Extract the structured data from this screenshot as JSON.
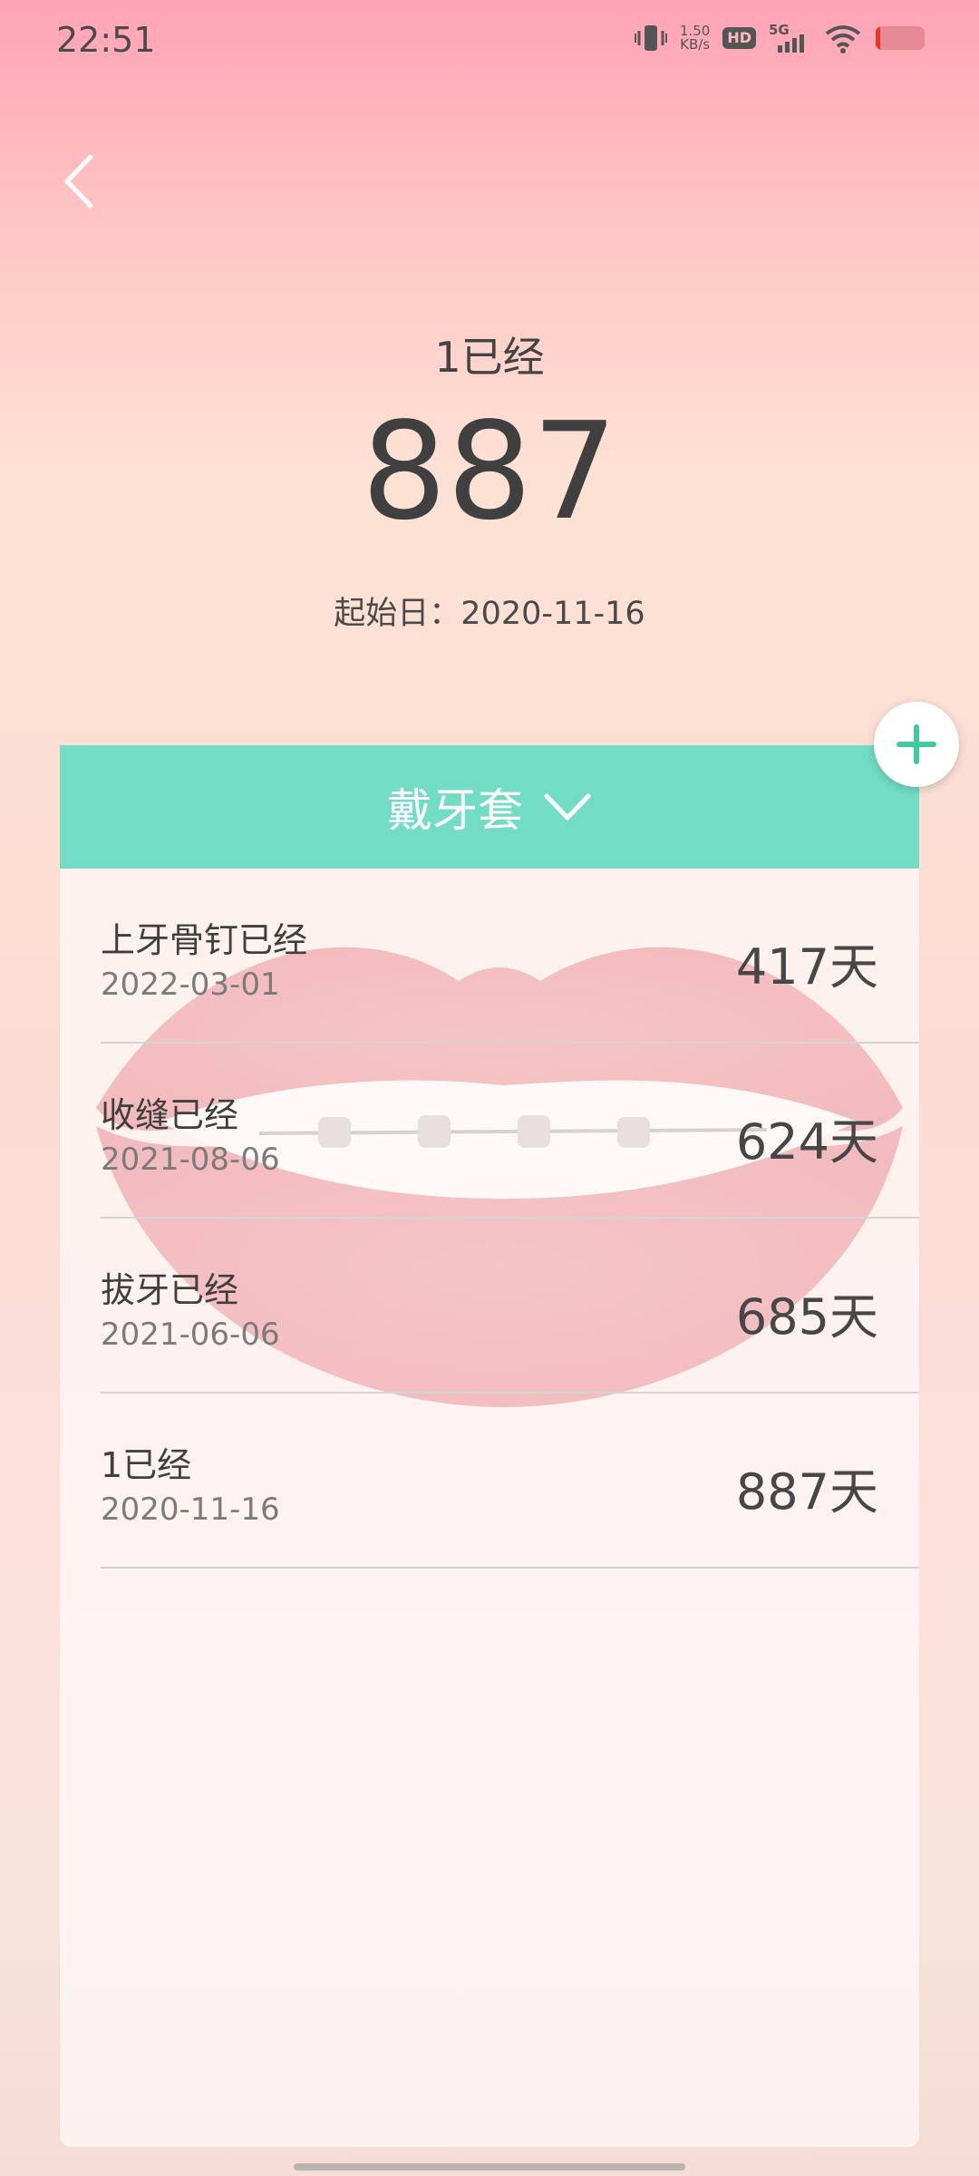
{
  "status_bar": {
    "time": "22:51",
    "net_speed_value": "1.50",
    "net_speed_unit": "KB/s",
    "hd_label": "HD",
    "network_label": "5G",
    "battery_level_percent": 10,
    "battery_color": "#e8322b"
  },
  "header": {
    "title": "1已经",
    "days": "887",
    "start_date": "起始日：2020-11-16"
  },
  "card": {
    "category": "戴牙套",
    "header_color": "#72ddc4",
    "records": [
      {
        "name": "上牙骨钉已经",
        "date": "2022-03-01",
        "days": "417天"
      },
      {
        "name": "收缝已经",
        "date": "2021-08-06",
        "days": "624天"
      },
      {
        "name": "拔牙已经",
        "date": "2021-06-06",
        "days": "685天"
      },
      {
        "name": "1已经",
        "date": "2020-11-16",
        "days": "887天"
      }
    ]
  },
  "icons": {
    "back": "chevron-left-icon",
    "dropdown": "chevron-down-icon",
    "add": "plus-icon"
  },
  "accent_color": "#3fcaa3"
}
